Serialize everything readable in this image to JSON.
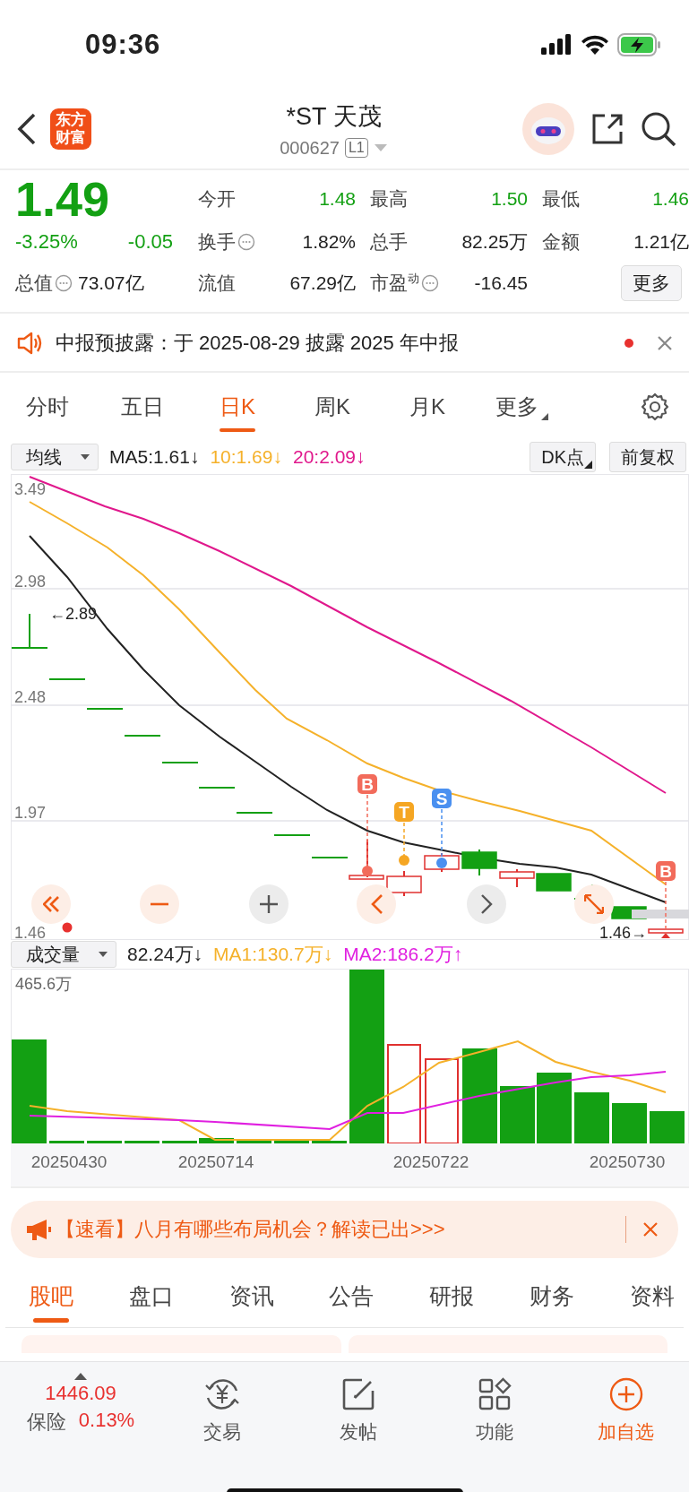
{
  "status_bar": {
    "time": "09:36"
  },
  "header": {
    "logo_text": "东方财富",
    "title": "*ST 天茂",
    "code": "000627",
    "level_badge": "L1"
  },
  "quote": {
    "price": "1.49",
    "color": "#13a013",
    "change_pct": "-3.25%",
    "change": "-0.05",
    "stats": [
      {
        "label": "今开",
        "value": "1.48",
        "color": "#13a013",
        "info": false
      },
      {
        "label": "最高",
        "value": "1.50",
        "color": "#13a013",
        "info": false
      },
      {
        "label": "最低",
        "value": "1.46",
        "color": "#13a013",
        "info": false
      },
      {
        "label": "换手",
        "value": "1.82%",
        "color": "#222222",
        "info": true
      },
      {
        "label": "总手",
        "value": "82.25万",
        "color": "#222222",
        "info": false
      },
      {
        "label": "金额",
        "value": "1.21亿",
        "color": "#222222",
        "info": false
      },
      {
        "label": "总值",
        "value": "73.07亿",
        "color": "#222222",
        "info": true
      },
      {
        "label": "流值",
        "value": "67.29亿",
        "color": "#222222",
        "info": false
      },
      {
        "label": "市盈$^{动}$",
        "value": "-16.45",
        "color": "#222222",
        "info": true
      }
    ],
    "more_button": "更多"
  },
  "notice": {
    "text": "中报预披露：于 2025-08-29 披露 2025 年中报",
    "unread": true
  },
  "period_tabs": [
    {
      "label": "分时",
      "selected": false,
      "kind": "tab"
    },
    {
      "label": "五日",
      "selected": false,
      "kind": "tab"
    },
    {
      "label": "日K",
      "selected": true,
      "kind": "tab"
    },
    {
      "label": "周K",
      "selected": false,
      "kind": "tab"
    },
    {
      "label": "月K",
      "selected": false,
      "kind": "tab"
    },
    {
      "label": "更多",
      "selected": false,
      "kind": "menu"
    }
  ],
  "kline": {
    "indicator": "均线",
    "readings": [
      {
        "text": "MA5:1.61↓",
        "color": "#222222"
      },
      {
        "text": "10:1.69↓",
        "color": "#f5b12a"
      },
      {
        "text": "20:2.09↓",
        "color": "#e0188c"
      }
    ],
    "buttons": [
      "DK点",
      "前复权"
    ],
    "price_labels": [
      "3.49",
      "2.98",
      "2.48",
      "1.97",
      "1.46"
    ],
    "high_label": "←2.89",
    "low_label": "1.46→",
    "signals": [
      {
        "letter": "B",
        "color": "#f26b5b"
      },
      {
        "letter": "T",
        "color": "#f5a623"
      },
      {
        "letter": "S",
        "color": "#4a90f0"
      },
      {
        "letter": "B",
        "color": "#f26b5b"
      }
    ]
  },
  "volume": {
    "indicator": "成交量",
    "readings": [
      {
        "text": "82.24万↓",
        "color": "#222222"
      },
      {
        "text": "MA1:130.7万↓",
        "color": "#f5b12a"
      },
      {
        "text": "MA2:186.2万↑",
        "color": "#e020e0"
      }
    ],
    "max_label": "465.6万",
    "dates": [
      "20250430",
      "20250714",
      "20250722",
      "20250730"
    ]
  },
  "banner": {
    "text": "【速看】八月有哪些布局机会？解读已出>>>"
  },
  "info_tabs": [
    {
      "label": "股吧",
      "selected": true
    },
    {
      "label": "盘口",
      "selected": false
    },
    {
      "label": "资讯",
      "selected": false
    },
    {
      "label": "公告",
      "selected": false
    },
    {
      "label": "研报",
      "selected": false
    },
    {
      "label": "财务",
      "selected": false
    },
    {
      "label": "资料",
      "selected": false
    }
  ],
  "bottom_nav": {
    "index": {
      "value": "1446.09",
      "name": "保险",
      "change": "0.13%",
      "color": "#e8312f"
    },
    "items": [
      {
        "label": "交易",
        "kind": "trade",
        "highlighted": false
      },
      {
        "label": "发帖",
        "kind": "post",
        "highlighted": false
      },
      {
        "label": "功能",
        "kind": "apps",
        "highlighted": false
      },
      {
        "label": "加自选",
        "kind": "add",
        "highlighted": true
      }
    ]
  }
}
